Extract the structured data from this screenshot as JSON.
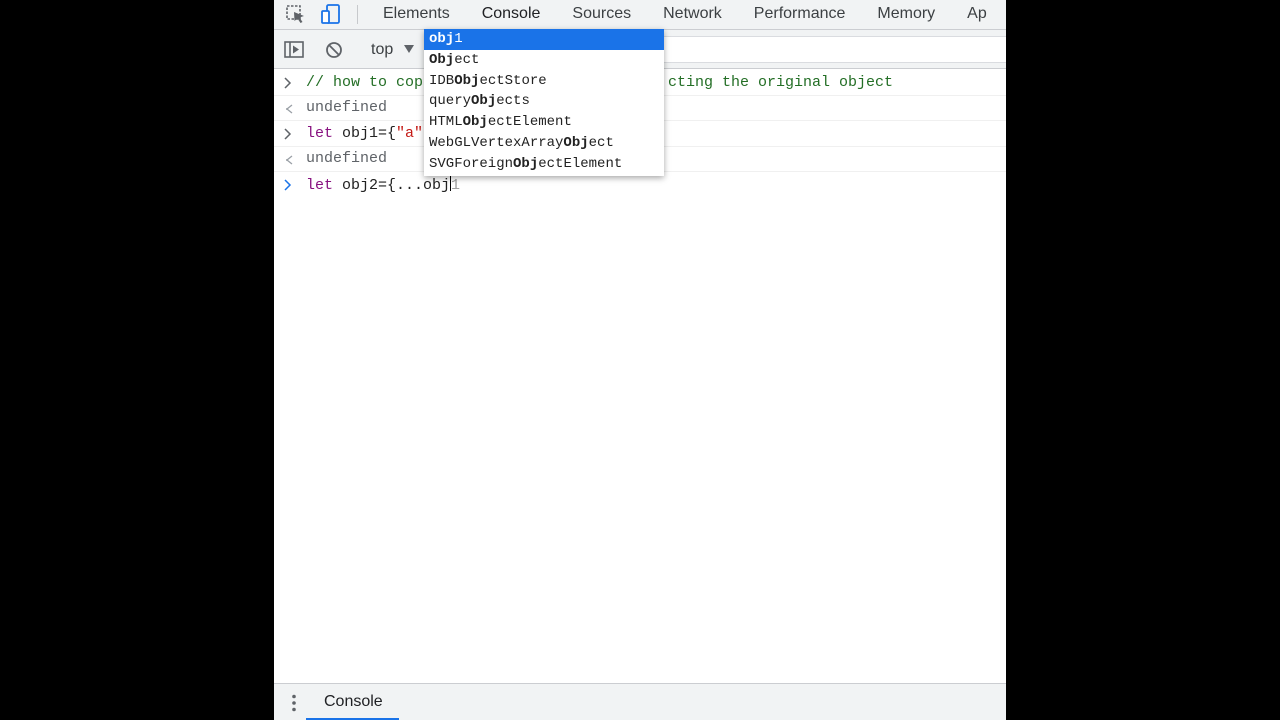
{
  "tabs": [
    "Elements",
    "Console",
    "Sources",
    "Network",
    "Performance",
    "Memory",
    "Ap"
  ],
  "active_tab": "Console",
  "toolbar": {
    "context": "top"
  },
  "console": {
    "line1": {
      "text_before": "// how to cop",
      "text_after": "cting the original object"
    },
    "line2": {
      "text": "undefined"
    },
    "line3": {
      "kw": "let",
      "code": " obj1={",
      "str": "\"a\""
    },
    "line4": {
      "text": "undefined"
    },
    "line5": {
      "kw": "let",
      "code": " obj2={...obj",
      "ghost": "1"
    }
  },
  "autocomplete": {
    "items": [
      {
        "pre": "",
        "match": "obj",
        "post": "1"
      },
      {
        "pre": "",
        "match": "Obj",
        "post": "ect"
      },
      {
        "pre": "IDB",
        "match": "Obj",
        "post": "ectStore"
      },
      {
        "pre": "query",
        "match": "Obj",
        "post": "ects"
      },
      {
        "pre": "HTML",
        "match": "Obj",
        "post": "ectElement"
      },
      {
        "pre": "WebGLVertexArray",
        "match": "Obj",
        "post": "ect"
      },
      {
        "pre": "SVGForeign",
        "match": "Obj",
        "post": "ectElement"
      }
    ],
    "selected_index": 0
  },
  "drawer": {
    "tab": "Console"
  },
  "colors": {
    "accent": "#1a73e8",
    "comment": "#236e25",
    "keyword": "#881280",
    "string": "#c41a16"
  }
}
